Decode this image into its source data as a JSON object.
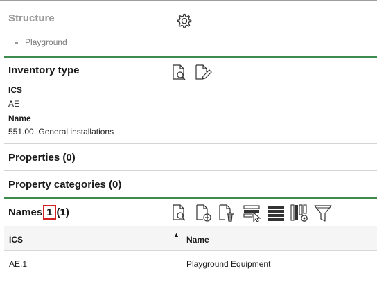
{
  "structure": {
    "title": "Structure",
    "breadcrumb": "Playground"
  },
  "inventory_type": {
    "title": "Inventory type",
    "fields": [
      {
        "label": "ICS",
        "value": "AE"
      },
      {
        "label": "Name",
        "value": "551.00. General installations"
      }
    ]
  },
  "properties": {
    "title": "Properties (0)"
  },
  "property_categories": {
    "title": "Property categories (0)"
  },
  "names": {
    "title": "Names",
    "badge": "1",
    "count": "(1)",
    "toolbar_icons": [
      "document-search-icon",
      "document-add-icon",
      "document-delete-icon",
      "row-select-icon",
      "rows-icon",
      "column-settings-icon",
      "filter-icon"
    ]
  },
  "table": {
    "columns": [
      "ICS",
      "Name"
    ],
    "sort_indicator": "▲",
    "rows": [
      {
        "ics": "AE.1",
        "name": "Playground Equipment"
      }
    ]
  },
  "colors": {
    "accent_green": "#3d8b4f",
    "badge_red": "#d32020"
  }
}
